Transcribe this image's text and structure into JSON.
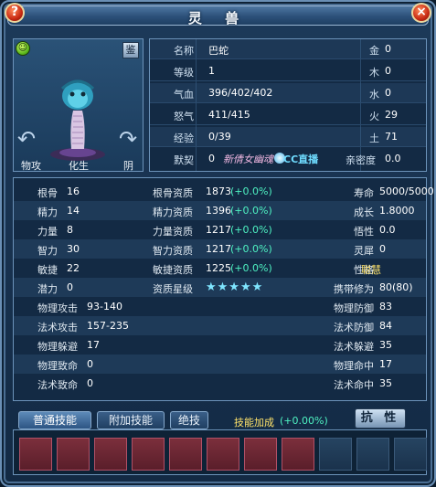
{
  "window": {
    "title": "灵  兽"
  },
  "buttons": {
    "help": "?",
    "close": "×",
    "appraise": "鉴",
    "resist": "抗 性"
  },
  "portrait": {
    "labels": {
      "left": "物攻",
      "center": "化生",
      "right": "阴"
    }
  },
  "info": {
    "rows": [
      {
        "key": "名称",
        "value": "巴蛇",
        "extra_key": "金",
        "extra_value": "0"
      },
      {
        "key": "等级",
        "value": "1",
        "extra_key": "木",
        "extra_value": "0"
      },
      {
        "key": "气血",
        "value": "396/402/402",
        "extra_key": "水",
        "extra_value": "0"
      },
      {
        "key": "怒气",
        "value": "411/415",
        "extra_key": "火",
        "extra_value": "29"
      },
      {
        "key": "经验",
        "value": "0/39",
        "extra_key": "土",
        "extra_value": "71"
      },
      {
        "key": "默契",
        "value": "0",
        "extra_key": "亲密度",
        "extra_value": "0.0"
      }
    ],
    "logo_text_a": "新倩女幽魂",
    "logo_text_b": "CC直播"
  },
  "stats": {
    "rows": [
      {
        "k1": "根骨",
        "v1": "16",
        "k2": "根骨资质",
        "v2": "1873",
        "g2": "(+0.0%)",
        "k3": "寿命",
        "v3": "5000/5000"
      },
      {
        "k1": "精力",
        "v1": "14",
        "k2": "精力资质",
        "v2": "1396",
        "g2": "(+0.0%)",
        "k3": "成长",
        "v3": "1.8000"
      },
      {
        "k1": "力量",
        "v1": "8",
        "k2": "力量资质",
        "v2": "1217",
        "g2": "(+0.0%)",
        "k3": "悟性",
        "v3": "0.0"
      },
      {
        "k1": "智力",
        "v1": "30",
        "k2": "智力资质",
        "v2": "1217",
        "g2": "(+0.0%)",
        "k3": "灵犀",
        "v3": "0"
      },
      {
        "k1": "敏捷",
        "v1": "22",
        "k2": "敏捷资质",
        "v2": "1225",
        "g2": "(+0.0%)",
        "k3": "性格",
        "v3": "聪慧"
      },
      {
        "k1": "潜力",
        "v1": "0",
        "k2": "资质星级",
        "stars": "★★★★★",
        "k3": "携带修为",
        "v3": "80(80)"
      }
    ],
    "wide_rows": [
      {
        "k1": "物理攻击",
        "v1": "93-140",
        "k3": "物理防御",
        "v3": "83"
      },
      {
        "k1": "法术攻击",
        "v1": "157-235",
        "k3": "法术防御",
        "v3": "84"
      },
      {
        "k1": "物理躲避",
        "v1": "17",
        "k3": "法术躲避",
        "v3": "35"
      },
      {
        "k1": "物理致命",
        "v1": "0",
        "k3": "物理命中",
        "v3": "17"
      },
      {
        "k1": "法术致命",
        "v1": "0",
        "k3": "法术命中",
        "v3": "35"
      }
    ]
  },
  "tabs": [
    {
      "label": "普通技能",
      "active": true
    },
    {
      "label": "附加技能",
      "active": false
    },
    {
      "label": "绝技",
      "active": false
    }
  ],
  "skill_bonus": {
    "label": "技能加成",
    "value": "(+0.00%)"
  },
  "skill_slots": {
    "filled": 8,
    "total": 11
  },
  "colors": {
    "accent_green": "#4ef2c2",
    "gold": "#ffe36a",
    "star_blue": "#7fe6ff"
  }
}
